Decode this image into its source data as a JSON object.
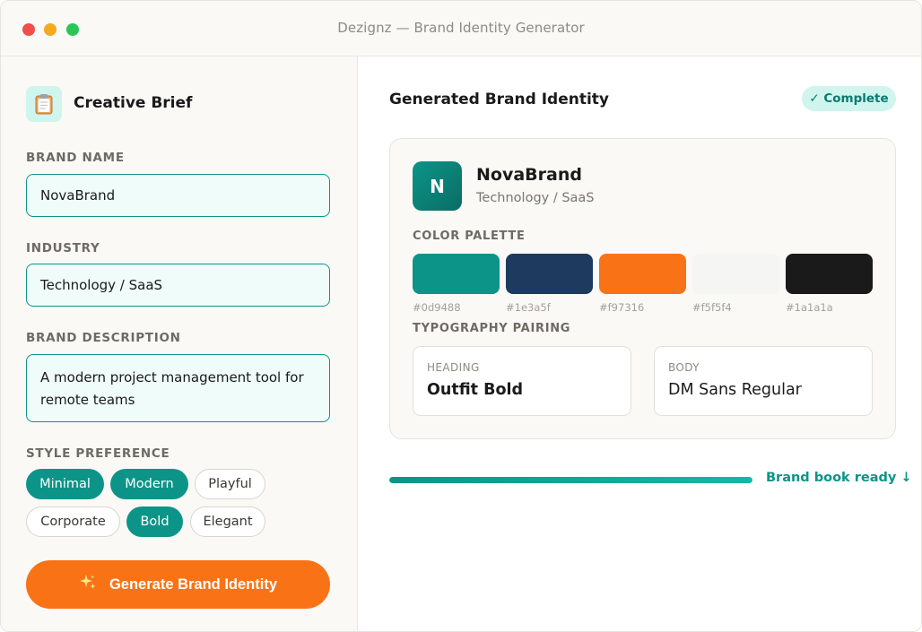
{
  "window": {
    "title": "Dezignz — Brand Identity Generator"
  },
  "brief": {
    "title": "Creative Brief",
    "brand_name_label": "BRAND NAME",
    "brand_name_value": "NovaBrand",
    "industry_label": "INDUSTRY",
    "industry_value": "Technology / SaaS",
    "description_label": "BRAND DESCRIPTION",
    "description_value": "A modern project management tool for remote teams",
    "style_label": "STYLE PREFERENCE",
    "styles": [
      {
        "label": "Minimal",
        "selected": true
      },
      {
        "label": "Modern",
        "selected": true
      },
      {
        "label": "Playful",
        "selected": false
      },
      {
        "label": "Corporate",
        "selected": false
      },
      {
        "label": "Bold",
        "selected": true
      },
      {
        "label": "Elegant",
        "selected": false
      }
    ],
    "generate_label": "Generate Brand Identity",
    "generate_icon": "sparkles-icon"
  },
  "result": {
    "title": "Generated Brand Identity",
    "status": "✓ Complete",
    "logo_letter": "N",
    "brand_name": "NovaBrand",
    "brand_industry": "Technology / SaaS",
    "palette_label": "COLOR PALETTE",
    "palette": [
      "#0d9488",
      "#1e3a5f",
      "#f97316",
      "#f5f5f4",
      "#1a1a1a"
    ],
    "typography_label": "TYPOGRAPHY PAIRING",
    "heading_caption": "HEADING",
    "heading_font": "Outfit Bold",
    "body_caption": "BODY",
    "body_font": "DM Sans Regular",
    "progress": 1.0,
    "ready_label": "Brand book ready ↓"
  },
  "colors": {
    "accent": "#0d9488",
    "cta": "#f97316"
  }
}
